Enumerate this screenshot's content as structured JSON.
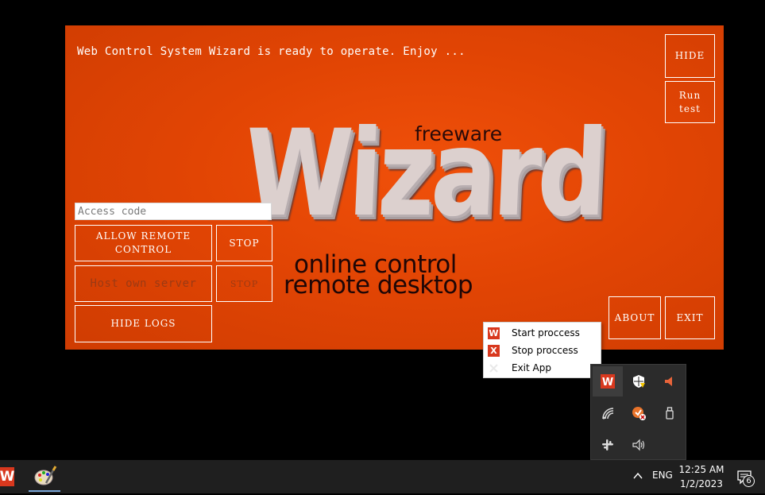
{
  "window": {
    "status_text": "Web Control System Wizard is ready to operate. Enjoy ...",
    "hide_button": "HIDE",
    "run_test_button": "Run\ntest",
    "access_code_placeholder": "Access code",
    "allow_remote_button": "ALLOW REMOTE\nCONTROL",
    "stop_button_1": "STOP",
    "host_server_button": "Host own server",
    "stop_button_2": "STOP",
    "hide_logs_button": "HIDE LOGS",
    "about_button": "ABOUT",
    "exit_button": "EXIT",
    "accent_color": "#e24504"
  },
  "logo": {
    "main": "Wizard",
    "badge": "freeware",
    "line1": "online control",
    "line2": "remote desktop"
  },
  "context_menu": {
    "items": [
      {
        "label": "Start proccess",
        "icon": "W",
        "icon_name": "start-icon"
      },
      {
        "label": "Stop proccess",
        "icon": "X",
        "icon_name": "stop-icon"
      },
      {
        "label": "Exit App",
        "icon": "",
        "icon_name": "exit-icon"
      }
    ]
  },
  "tray": {
    "icons": [
      "wizard-tray-icon",
      "security-warning-icon",
      "speaker-muted-icon",
      "wifi-icon",
      "vpn-icon",
      "usb-icon",
      "slack-icon",
      "volume-icon"
    ]
  },
  "taskbar": {
    "app_letter": "W",
    "language": "ENG",
    "time": "12:25 AM",
    "date": "1/2/2023",
    "notification_count": "6"
  }
}
